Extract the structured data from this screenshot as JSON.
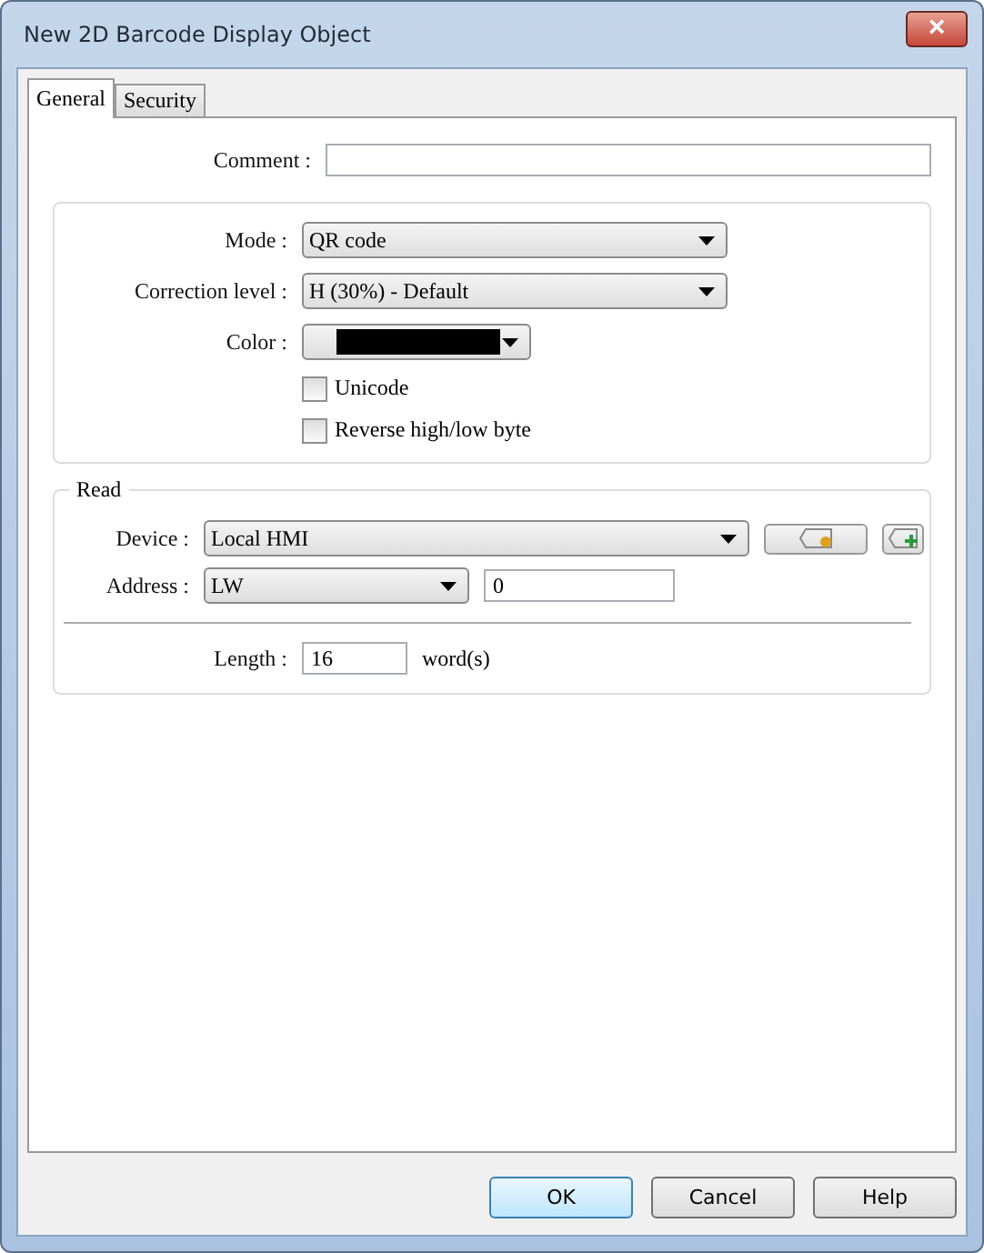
{
  "window": {
    "title": "New 2D Barcode Display Object",
    "close": "×"
  },
  "tabs": [
    {
      "label": "General",
      "selected": true
    },
    {
      "label": "Security",
      "selected": false
    }
  ],
  "comment": {
    "label": "Comment :"
  },
  "barcode": {
    "mode": {
      "label": "Mode :",
      "value": "QR code"
    },
    "correction": {
      "label": "Correction level  :",
      "value": "H (30%) - Default"
    },
    "color": {
      "label": "Color :",
      "color": "#000000"
    },
    "options": [
      {
        "label": "Unicode",
        "checked": false
      },
      {
        "label": "Reverse high/low byte",
        "checked": false
      }
    ]
  },
  "read": {
    "title": "Read",
    "device": {
      "label": "Device :",
      "value": "Local HMI"
    },
    "address": {
      "label": "Address :",
      "type": "LW",
      "value": "0"
    },
    "length": {
      "label": "Length :",
      "value": "16",
      "unit": "word(s)"
    }
  },
  "buttons": [
    {
      "label": "OK",
      "default": true
    },
    {
      "label": "Cancel",
      "default": false
    },
    {
      "label": "Help",
      "default": false
    }
  ]
}
